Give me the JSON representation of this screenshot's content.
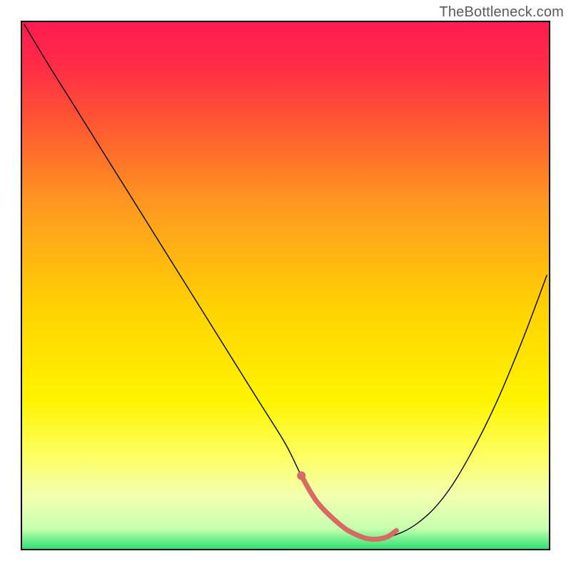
{
  "watermark": "TheBottleneck.com",
  "chart_data": {
    "type": "line",
    "title": "",
    "xlabel": "",
    "ylabel": "",
    "xlim": [
      0,
      100
    ],
    "ylim": [
      0,
      100
    ],
    "background_gradient": {
      "stops": [
        {
          "offset": 0.0,
          "color": "#ff1a52"
        },
        {
          "offset": 0.08,
          "color": "#ff2a48"
        },
        {
          "offset": 0.2,
          "color": "#ff5a30"
        },
        {
          "offset": 0.35,
          "color": "#ff9a20"
        },
        {
          "offset": 0.55,
          "color": "#ffd400"
        },
        {
          "offset": 0.72,
          "color": "#fff400"
        },
        {
          "offset": 0.82,
          "color": "#fdff60"
        },
        {
          "offset": 0.9,
          "color": "#f2ffb0"
        },
        {
          "offset": 0.96,
          "color": "#c8ffb0"
        },
        {
          "offset": 1.0,
          "color": "#28e070"
        }
      ]
    },
    "series": [
      {
        "name": "bottleneck-curve",
        "color": "#000000",
        "stroke_width": 1.4,
        "x": [
          0.5,
          5,
          10,
          15,
          20,
          25,
          30,
          35,
          40,
          45,
          50,
          53,
          56,
          60,
          63,
          66,
          70,
          75,
          80,
          85,
          90,
          95,
          99.5
        ],
        "values": [
          99.5,
          92,
          84,
          76,
          68,
          60,
          52,
          44,
          36,
          28,
          20,
          14,
          9,
          5,
          3,
          2,
          2.5,
          5,
          10,
          18,
          28,
          40,
          52
        ]
      },
      {
        "name": "highlight-segment",
        "color": "#d76a62",
        "stroke_width": 7,
        "linecap": "round",
        "x": [
          53,
          56,
          60,
          63,
          66,
          69,
          71
        ],
        "values": [
          14,
          9,
          5,
          3,
          2,
          2.3,
          3.6
        ]
      }
    ],
    "highlight_dots": {
      "color": "#d76a62",
      "radius": 6,
      "points": [
        {
          "x": 53,
          "y": 14
        }
      ]
    }
  }
}
